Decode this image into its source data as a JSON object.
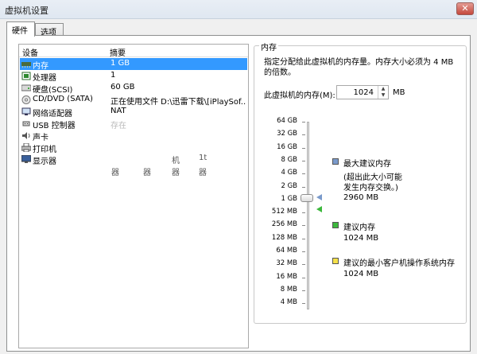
{
  "window": {
    "title": "虚拟机设置",
    "close_glyph": "✕"
  },
  "tabs": [
    {
      "label": "硬件",
      "active": true
    },
    {
      "label": "选项",
      "active": false
    }
  ],
  "device_list": {
    "headers": {
      "device": "设备",
      "summary": "摘要"
    },
    "rows": [
      {
        "icon": "memory-icon",
        "name": "内存",
        "value": "1 GB",
        "selected": true
      },
      {
        "icon": "processor-icon",
        "name": "处理器",
        "value": "1"
      },
      {
        "icon": "hard-disk-icon",
        "name": "硬盘(SCSI)",
        "value": "60 GB"
      },
      {
        "icon": "cd-dvd-icon",
        "name": "CD/DVD (SATA)",
        "value": "正在使用文件 D:\\迅雷下载\\[iPlaySof..."
      },
      {
        "icon": "network-adapter-icon",
        "name": "网络适配器",
        "value": "NAT"
      },
      {
        "icon": "usb-controller-icon",
        "name": "USB 控制器",
        "value": "存在"
      },
      {
        "icon": "sound-card-icon",
        "name": "声卡",
        "value": ""
      },
      {
        "icon": "printer-icon",
        "name": "打印机",
        "value": ""
      },
      {
        "icon": "display-icon",
        "name": "显示器",
        "value": ""
      }
    ],
    "garbled_fragments": [
      "机",
      "1t",
      "器",
      "器",
      "器",
      "器"
    ]
  },
  "memory": {
    "group_label": "内存",
    "description": "指定分配给此虚拟机的内存量。内存大小必须为 4 MB 的倍数。",
    "field_label": "此虚拟机的内存(M):",
    "value": "1024",
    "unit": "MB",
    "scale_labels": [
      "64 GB",
      "32 GB",
      "16 GB",
      "8 GB",
      "4 GB",
      "2 GB",
      "1 GB",
      "512 MB",
      "256 MB",
      "128 MB",
      "64 MB",
      "32 MB",
      "16 MB",
      "8 MB",
      "4 MB"
    ],
    "legend": {
      "max": {
        "title": "最大建议内存",
        "note1": "(超出此大小可能",
        "note2": "发生内存交换。)",
        "value": "2960 MB",
        "color": "#7a9acb"
      },
      "recommended": {
        "title": "建议内存",
        "value": "1024 MB",
        "color": "#3cb83c"
      },
      "min_guest": {
        "title": "建议的最小客户机操作系统内存",
        "value": "1024 MB",
        "color": "#f5e14a"
      }
    }
  }
}
